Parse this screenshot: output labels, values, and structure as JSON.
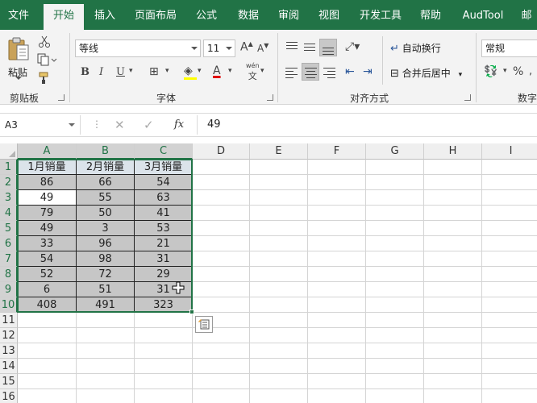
{
  "ribbon_tabs": [
    "文件",
    "开始",
    "插入",
    "页面布局",
    "公式",
    "数据",
    "审阅",
    "视图",
    "开发工具",
    "帮助",
    "AudTool",
    "邮"
  ],
  "clipboard": {
    "paste_label": "粘贴",
    "group_label": "剪贴板"
  },
  "font": {
    "name": "等线",
    "size": "11",
    "group_label": "字体",
    "bold": "B",
    "italic": "I",
    "underline": "U",
    "grow": "A",
    "shrink": "A",
    "phonetic": "wén",
    "phonetic_glyph": "文",
    "font_color_letter": "A"
  },
  "alignment": {
    "wrap_label": "自动换行",
    "merge_label": "合并后居中",
    "group_label": "对齐方式"
  },
  "number": {
    "format": "常规",
    "percent": "%",
    "group_label": "数字"
  },
  "formula_bar": {
    "name_box": "A3",
    "fx": "fx",
    "value": "49"
  },
  "columns": [
    "A",
    "B",
    "C",
    "D",
    "E",
    "F",
    "G",
    "H",
    "I"
  ],
  "row_numbers": [
    "1",
    "2",
    "3",
    "4",
    "5",
    "6",
    "7",
    "8",
    "9",
    "10",
    "11",
    "12",
    "13",
    "14",
    "15",
    "16"
  ],
  "table": {
    "headers": [
      "1月销量",
      "2月销量",
      "3月销量"
    ],
    "rows": [
      [
        "86",
        "66",
        "54"
      ],
      [
        "49",
        "55",
        "63"
      ],
      [
        "79",
        "50",
        "41"
      ],
      [
        "49",
        "3",
        "53"
      ],
      [
        "33",
        "96",
        "21"
      ],
      [
        "54",
        "98",
        "31"
      ],
      [
        "52",
        "72",
        "29"
      ],
      [
        "6",
        "51",
        "31"
      ],
      [
        "408",
        "491",
        "323"
      ]
    ]
  },
  "colors": {
    "accent": "#217346",
    "selection": "#c6c6c6",
    "header_fill": "#dbe3ea"
  }
}
